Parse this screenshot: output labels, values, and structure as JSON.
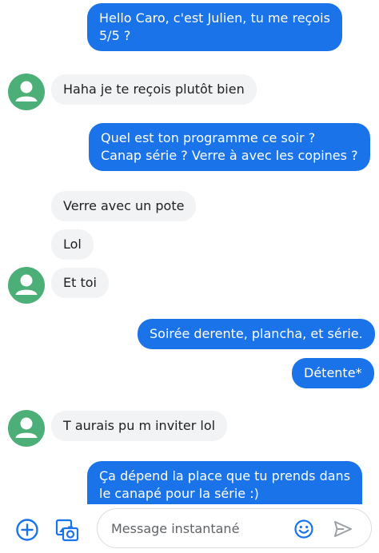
{
  "conversation": {
    "messages": [
      {
        "direction": "outgoing",
        "lines": [
          "Hello Caro, c'est Julien, tu me reçois",
          "5/5 ?"
        ]
      },
      {
        "direction": "incoming",
        "lines": [
          "Haha je te reçois plutôt bien"
        ]
      },
      {
        "direction": "outgoing",
        "lines": [
          "Quel est ton programme ce soir ?",
          "Canap série ? Verre à avec les copines ?"
        ]
      },
      {
        "direction": "incoming",
        "lines": [
          "Verre avec un pote"
        ]
      },
      {
        "direction": "incoming",
        "lines": [
          "Lol"
        ]
      },
      {
        "direction": "incoming",
        "lines": [
          "Et toi"
        ]
      },
      {
        "direction": "outgoing",
        "lines": [
          "Soirée derente, plancha, et série."
        ]
      },
      {
        "direction": "outgoing",
        "lines": [
          "Détente*"
        ]
      },
      {
        "direction": "incoming",
        "lines": [
          "T aurais pu m inviter lol"
        ]
      },
      {
        "direction": "outgoing",
        "lines": [
          "Ça dépend la place que tu prends dans",
          "le canapé pour la série :)"
        ]
      }
    ]
  },
  "composer": {
    "placeholder": "Message instantané",
    "icons": {
      "add": "add-circle-icon",
      "gallery": "gallery-icon",
      "emoji": "emoji-icon",
      "send": "send-icon"
    }
  },
  "colors": {
    "outgoing_bubble": "#1a73e8",
    "incoming_bubble": "#f1f3f4",
    "avatar": "#4caf78",
    "icon_blue": "#1a73e8"
  }
}
